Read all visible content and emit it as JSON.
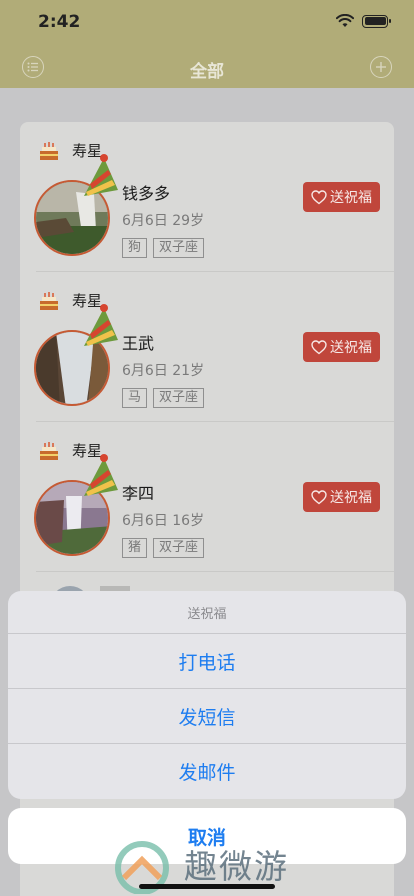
{
  "status_bar": {
    "time": "2:42"
  },
  "nav": {
    "title": "全部",
    "left_icon": "list-icon",
    "right_icon": "add-icon"
  },
  "colors": {
    "header": "#b1ac78",
    "accent_red": "#c0463b",
    "link_blue": "#1e7df0",
    "avatar_ring": "#c55a34"
  },
  "birthdays": [
    {
      "label": "寿星",
      "name": "钱多多",
      "date_age": "6月6日 29岁",
      "tags": [
        "狗",
        "双子座"
      ],
      "button": "送祝福"
    },
    {
      "label": "寿星",
      "name": "王武",
      "date_age": "6月6日 21岁",
      "tags": [
        "马",
        "双子座"
      ],
      "button": "送祝福"
    },
    {
      "label": "寿星",
      "name": "李四",
      "date_age": "6月6日 16岁",
      "tags": [
        "猪",
        "双子座"
      ],
      "button": "送祝福"
    }
  ],
  "action_sheet": {
    "title": "送祝福",
    "options": [
      "打电话",
      "发短信",
      "发邮件"
    ],
    "cancel": "取消"
  },
  "watermark": {
    "text": "趣微游"
  }
}
